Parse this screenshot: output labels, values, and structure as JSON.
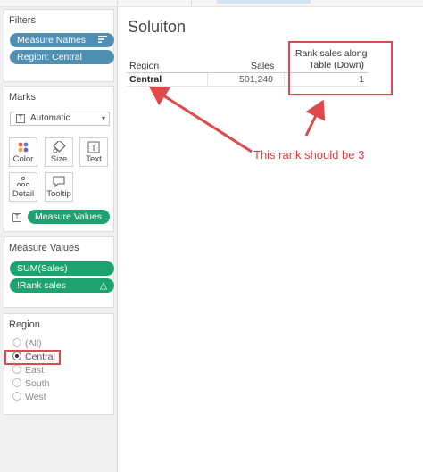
{
  "filters": {
    "title": "Filters",
    "pills": [
      {
        "label": "Measure Names",
        "icon": "sort-icon"
      },
      {
        "label": "Region: Central"
      }
    ]
  },
  "marks": {
    "title": "Marks",
    "mark_type": "Automatic",
    "buttons": [
      {
        "label": "Color",
        "icon": "color-icon"
      },
      {
        "label": "Size",
        "icon": "size-icon"
      },
      {
        "label": "Text",
        "icon": "text-icon"
      },
      {
        "label": "Detail",
        "icon": "detail-icon"
      },
      {
        "label": "Tooltip",
        "icon": "tooltip-icon"
      }
    ],
    "field_pill": "Measure Values"
  },
  "measure_values": {
    "title": "Measure Values",
    "pills": [
      {
        "label": "SUM(Sales)"
      },
      {
        "label": "!Rank sales",
        "badge": "△"
      }
    ]
  },
  "region_filter": {
    "title": "Region",
    "options": [
      "(All)",
      "Central",
      "East",
      "South",
      "West"
    ],
    "selected": "Central"
  },
  "view": {
    "title": "Soluiton",
    "columns": {
      "region": "Region",
      "sales": "Sales",
      "rank_line1": "!Rank sales along",
      "rank_line2": "Table (Down)"
    },
    "rows": [
      {
        "region": "Central",
        "sales": "501,240",
        "rank": "1"
      }
    ]
  },
  "annotation": {
    "text": "This rank should be 3",
    "color": "#e53b3b"
  },
  "colors": {
    "filter_pill": "#4f8fb3",
    "measure_pill": "#1ea370",
    "annotation": "#e0484c"
  }
}
